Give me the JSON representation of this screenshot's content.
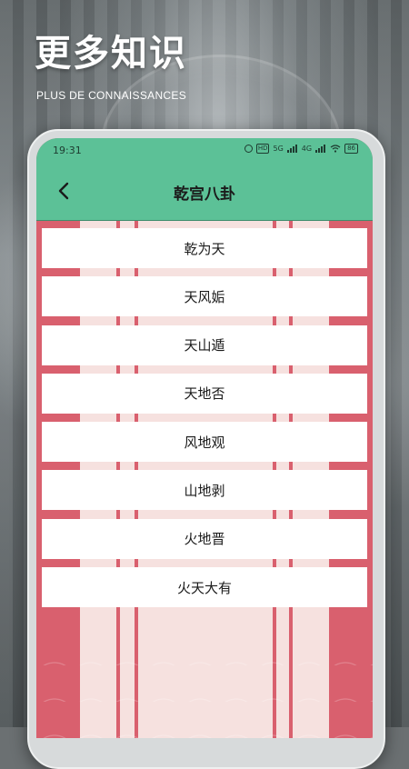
{
  "promo": {
    "title": "更多知识",
    "subtitle": "PLUS DE CONNAISSANCES"
  },
  "status_bar": {
    "time": "19:31",
    "icons": [
      "alarm-icon",
      "hd-icon",
      "5g-signal-icon",
      "4g-signal-icon",
      "wifi-icon",
      "battery-icon"
    ],
    "hd_label": "HD",
    "g5_label": "5G",
    "g4_label": "4G",
    "battery_label": "86"
  },
  "app_bar": {
    "back_icon": "chevron-left-icon",
    "title": "乾宫八卦"
  },
  "list": {
    "items": [
      "乾为天",
      "天风姤",
      "天山遁",
      "天地否",
      "风地观",
      "山地剥",
      "火地晋",
      "火天大有"
    ]
  },
  "colors": {
    "header": "#5cc197",
    "accent_red": "#d9606e",
    "panel": "#f6e1df",
    "card": "#ffffff"
  }
}
